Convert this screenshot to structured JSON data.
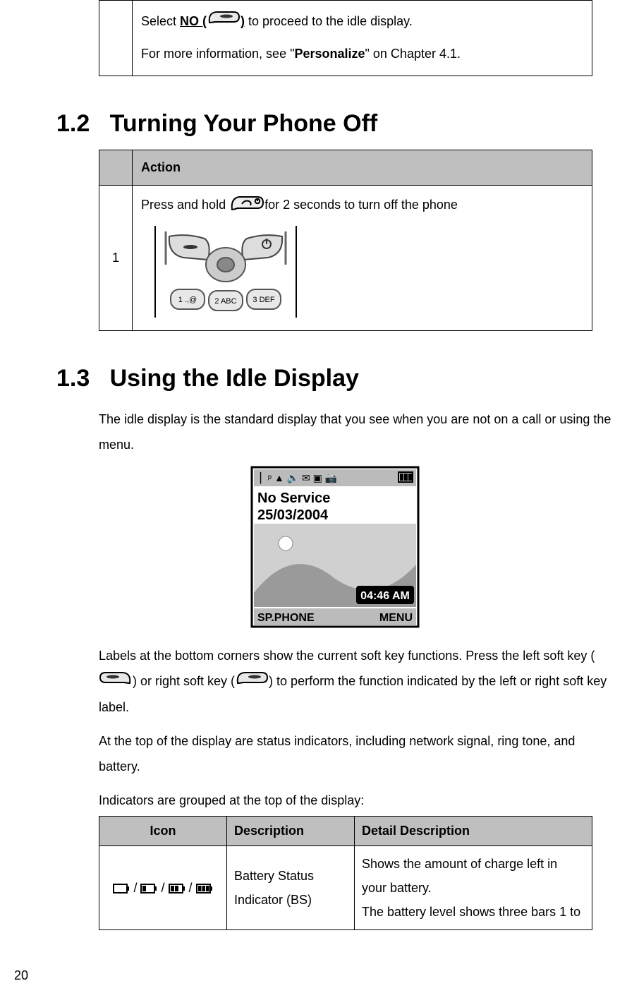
{
  "top_box": {
    "line1_pre": "Select ",
    "no_label": "NO (",
    "no_close": ")",
    "line1_post": " to proceed to the idle display.",
    "line2_pre": "For more information, see \"",
    "personalize": "Personalize",
    "line2_post": "\" on Chapter 4.1."
  },
  "sec12": {
    "title": "1.2   Turning Your Phone Off",
    "action_header": "Action",
    "step": "1",
    "text_pre": "Press and hold ",
    "text_post": "for 2 seconds to turn off the phone"
  },
  "sec13": {
    "title": "1.3   Using the Idle Display",
    "intro": "The idle display is the standard display that you see when you are not on a call or using the menu.",
    "labels_p_a": "Labels at the bottom corners show the current soft key functions. Press the left soft key (",
    "labels_p_b": ") or right soft key (",
    "labels_p_c": ") to perform the function indicated by the left or right soft key label.",
    "status_p": "At the top of the display are status indicators, including network signal, ring tone, and battery.",
    "grouped_p": "Indicators are grouped at the top of the display:"
  },
  "icon_table": {
    "h_icon": "Icon",
    "h_desc": "Description",
    "h_detail": "Detail Description",
    "row1": {
      "desc": "Battery Status Indicator (BS)",
      "detail": "Shows the amount of charge left in your battery.\nThe battery level shows three bars 1 to"
    }
  },
  "page_number": "20"
}
